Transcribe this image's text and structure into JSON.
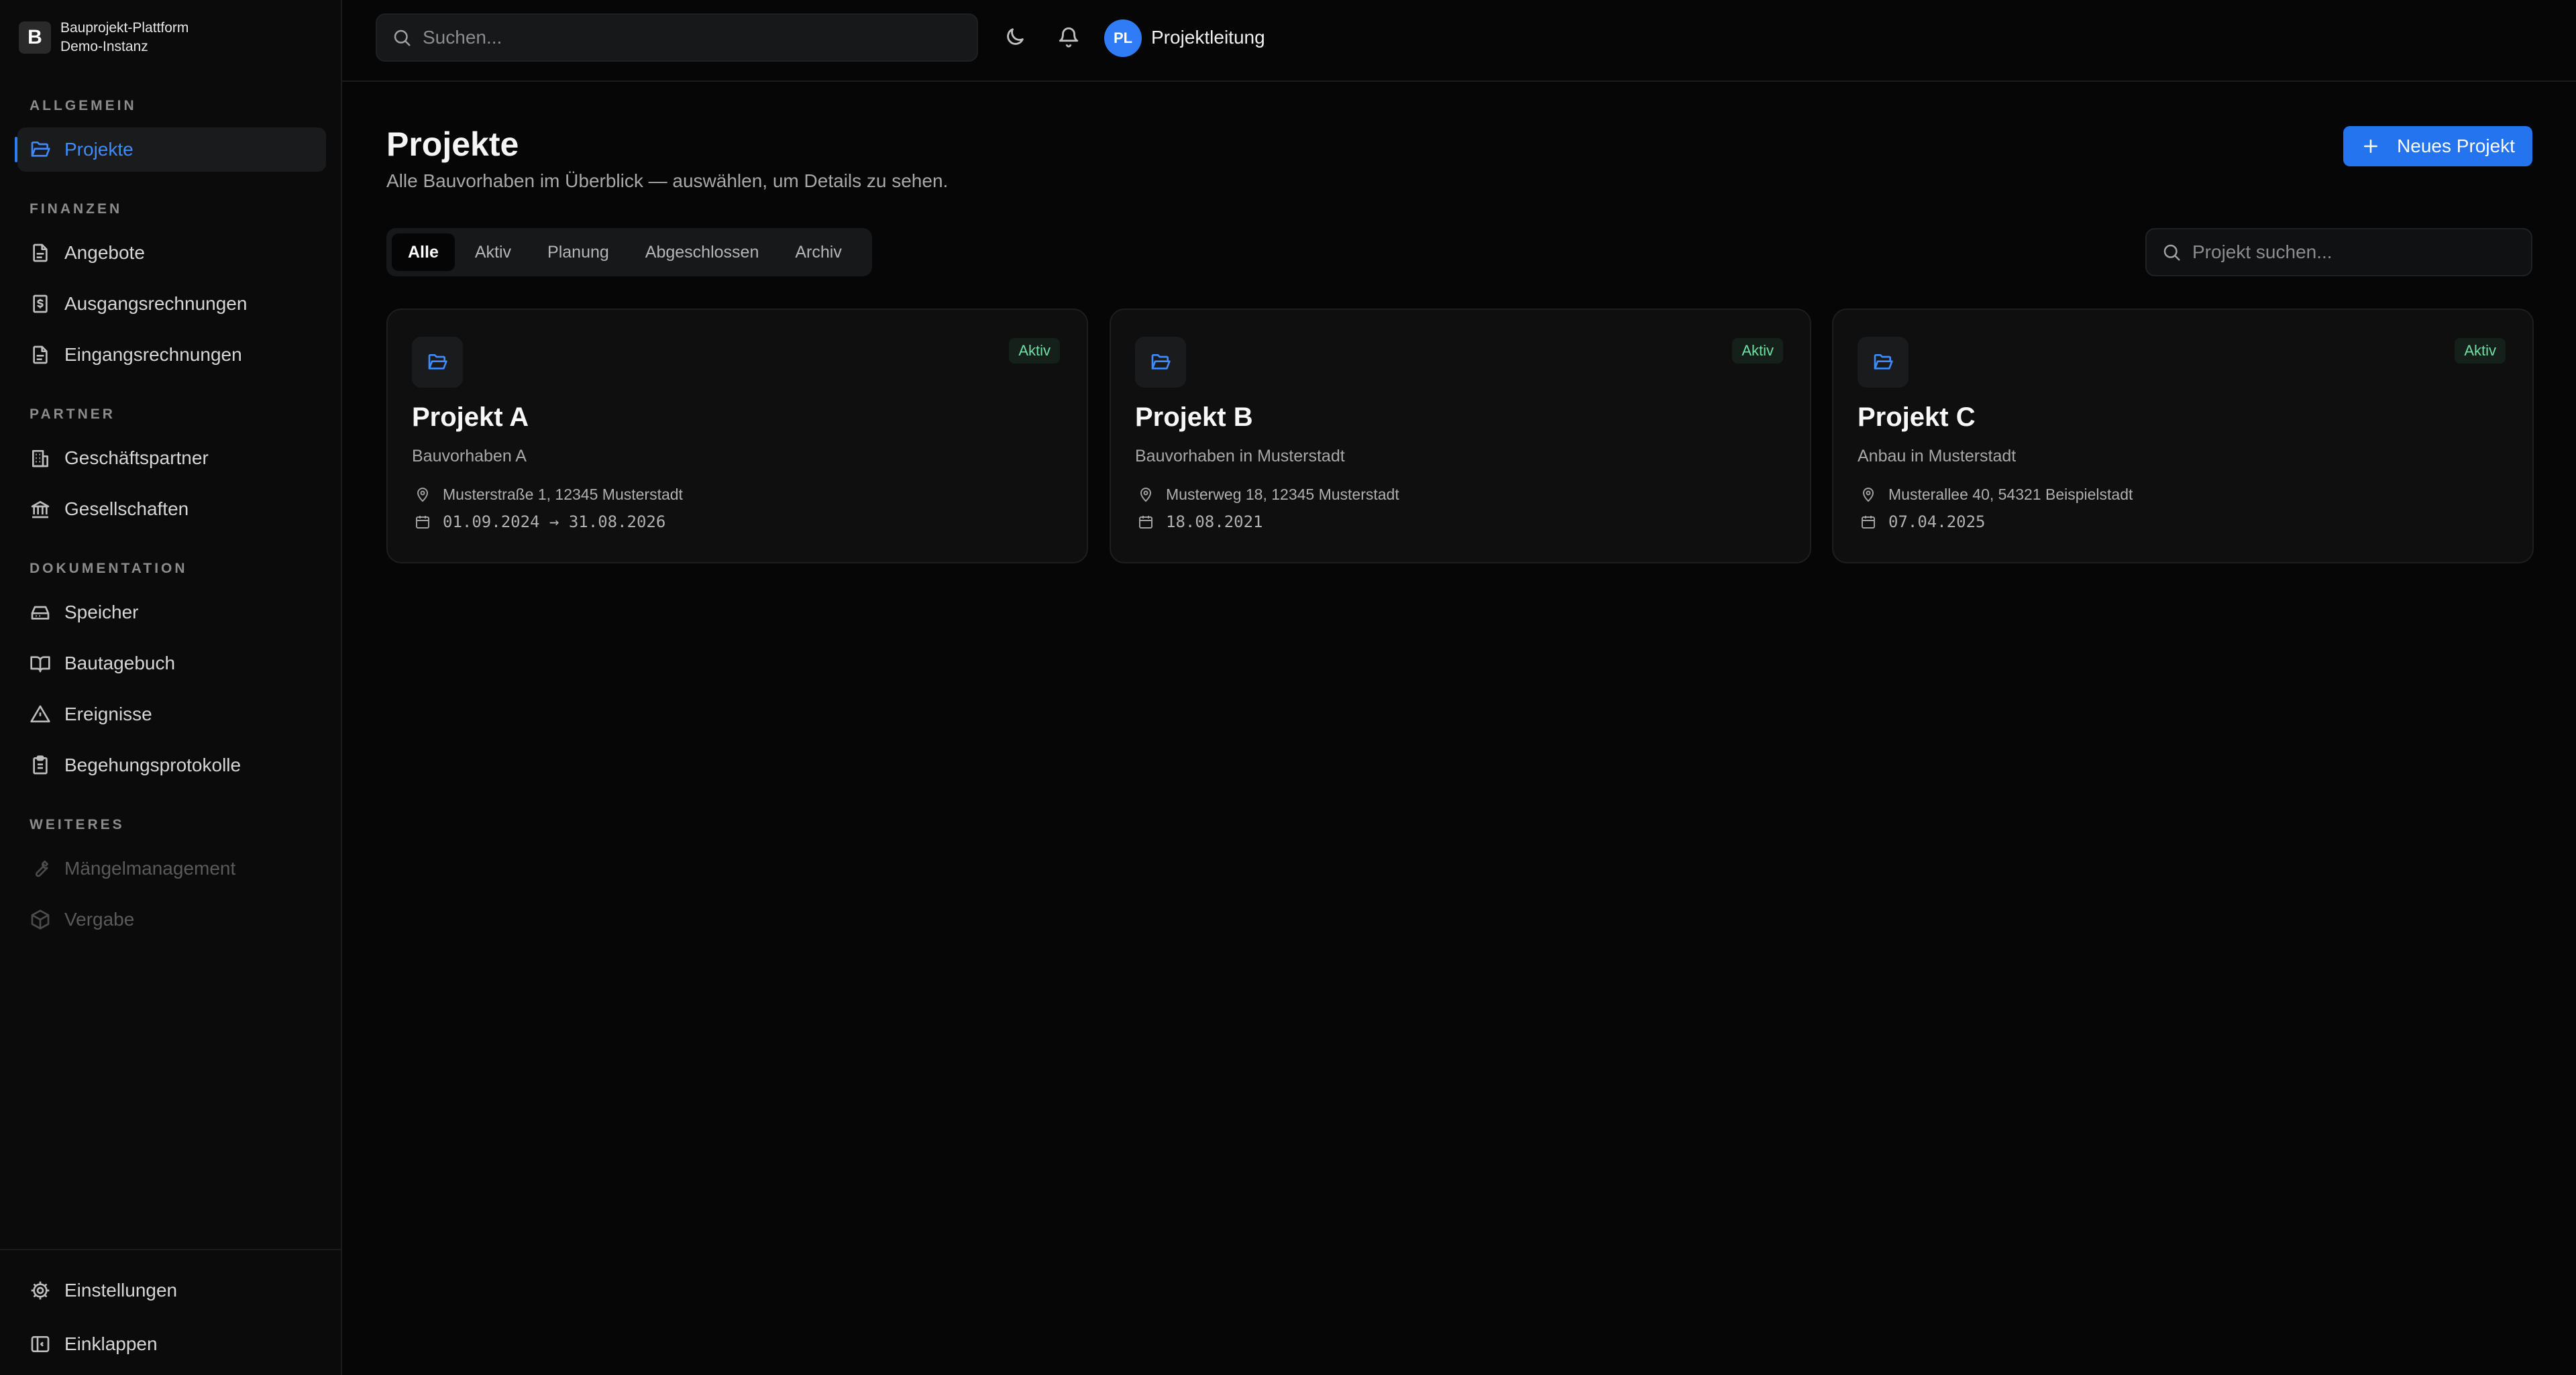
{
  "brand": {
    "logo_letter": "B",
    "name": "Bauprojekt-Plattform",
    "instance": "Demo-Instanz"
  },
  "sidebar": {
    "sections": [
      {
        "title": "ALLGEMEIN"
      },
      {
        "title": "FINANZEN"
      },
      {
        "title": "PARTNER"
      },
      {
        "title": "DOKUMENTATION"
      },
      {
        "title": "WEITERES"
      }
    ],
    "items": [
      {
        "label": "Projekte",
        "icon": "folder-open-icon",
        "state": "active"
      },
      {
        "label": "Angebote",
        "icon": "file-text-icon"
      },
      {
        "label": "Ausgangsrechnungen",
        "icon": "receipt-dollar-icon"
      },
      {
        "label": "Eingangsrechnungen",
        "icon": "file-text-icon"
      },
      {
        "label": "Geschäftspartner",
        "icon": "building-icon"
      },
      {
        "label": "Gesellschaften",
        "icon": "landmark-icon"
      },
      {
        "label": "Speicher",
        "icon": "hard-drive-icon"
      },
      {
        "label": "Bautagebuch",
        "icon": "book-open-icon"
      },
      {
        "label": "Ereignisse",
        "icon": "alert-triangle-icon"
      },
      {
        "label": "Begehungsprotokolle",
        "icon": "clipboard-list-icon"
      },
      {
        "label": "Mängelmanagement",
        "icon": "wrench-icon",
        "state": "disabled"
      },
      {
        "label": "Vergabe",
        "icon": "package-icon",
        "state": "disabled"
      }
    ],
    "footer": [
      {
        "label": "Einstellungen",
        "icon": "gear-icon"
      },
      {
        "label": "Einklappen",
        "icon": "panel-left-close-icon"
      }
    ]
  },
  "topbar": {
    "search_placeholder": "Suchen...",
    "user_initials": "PL",
    "user_name": "Projektleitung"
  },
  "main": {
    "title": "Projekte",
    "subtitle": "Alle Bauvorhaben im Überblick — auswählen, um Details zu sehen.",
    "new_button_label": "Neues Projekt",
    "tabs": [
      {
        "label": "Alle",
        "active": true
      },
      {
        "label": "Aktiv"
      },
      {
        "label": "Planung"
      },
      {
        "label": "Abgeschlossen"
      },
      {
        "label": "Archiv"
      }
    ],
    "project_search_placeholder": "Projekt suchen...",
    "projects": [
      {
        "title": "Projekt A",
        "description": "Bauvorhaben A",
        "status": "Aktiv",
        "address": "Musterstraße 1, 12345 Musterstadt",
        "date": "01.09.2024 → 31.08.2026"
      },
      {
        "title": "Projekt B",
        "description": "Bauvorhaben in Musterstadt",
        "status": "Aktiv",
        "address": "Musterweg 18, 12345 Musterstadt",
        "date": "18.08.2021"
      },
      {
        "title": "Projekt C",
        "description": "Anbau in Musterstadt",
        "status": "Aktiv",
        "address": "Musterallee 40, 54321 Beispielstadt",
        "date": "07.04.2025"
      }
    ]
  },
  "colors": {
    "accent": "#2f7cf6",
    "status_active": "#6fe0a6",
    "background": "#060606",
    "sidebar": "#0b0b0b"
  }
}
